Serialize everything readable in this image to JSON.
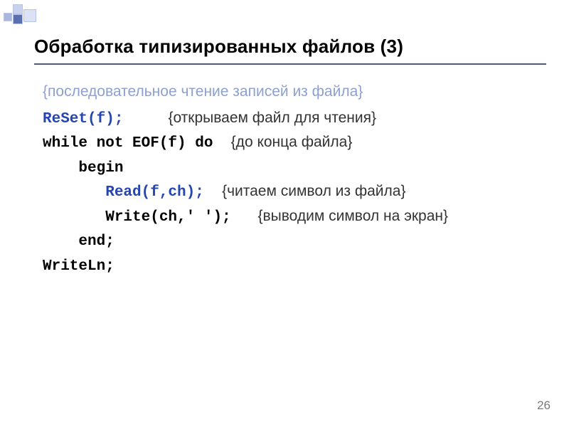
{
  "title": "Обработка типизированных файлов (3)",
  "subtitle": "{последовательное чтение записей из файла}",
  "code": {
    "l1_code": "ReSet(f);",
    "l1_pad": "     ",
    "l1_cm": "{открываем файл для чтения}",
    "l2_code": "while not EOF(f) do",
    "l2_pad": "  ",
    "l2_cm": "{до конца файла}",
    "l3_code": "    begin",
    "l4_indent": "       ",
    "l4_code": "Read(f,ch);",
    "l4_pad": "  ",
    "l4_cm": "{читаем символ из файла}",
    "l5_code": "       Write(ch,' ');",
    "l5_pad": "   ",
    "l5_cm": "{выводим символ на экран}",
    "l6_code": "    end;",
    "l7_code": "WriteLn;"
  },
  "page_number": "26"
}
